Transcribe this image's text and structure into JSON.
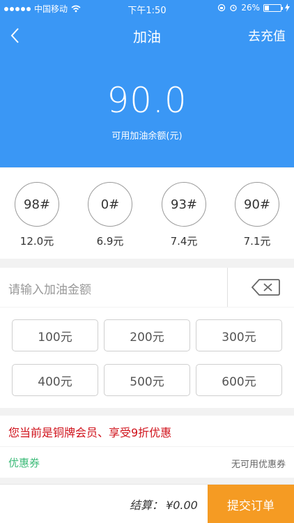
{
  "status_bar": {
    "carrier": "中国移动",
    "time": "下午1:50",
    "battery": "26%",
    "battery_level": 0.26
  },
  "nav": {
    "title": "加油",
    "right_action": "去充值"
  },
  "balance": {
    "value": "90.0",
    "label": "可用加油余额(元)"
  },
  "fuels": [
    {
      "grade": "98#",
      "price": "12.0元"
    },
    {
      "grade": "0#",
      "price": "6.9元"
    },
    {
      "grade": "93#",
      "price": "7.4元"
    },
    {
      "grade": "90#",
      "price": "7.1元"
    }
  ],
  "amount_input": {
    "placeholder": "请输入加油金额"
  },
  "amounts": [
    "100元",
    "200元",
    "300元",
    "400元",
    "500元",
    "600元"
  ],
  "member_notice": "您当前是铜牌会员、享受9折优惠",
  "coupon": {
    "label": "优惠券",
    "value": "无可用优惠券"
  },
  "checkout": {
    "label": "结算：",
    "amount": "¥0.00",
    "submit": "提交订单"
  },
  "colors": {
    "primary": "#3a97f5",
    "accent": "#f59b23",
    "notice": "#d0121b",
    "coupon": "#3dbb79"
  }
}
